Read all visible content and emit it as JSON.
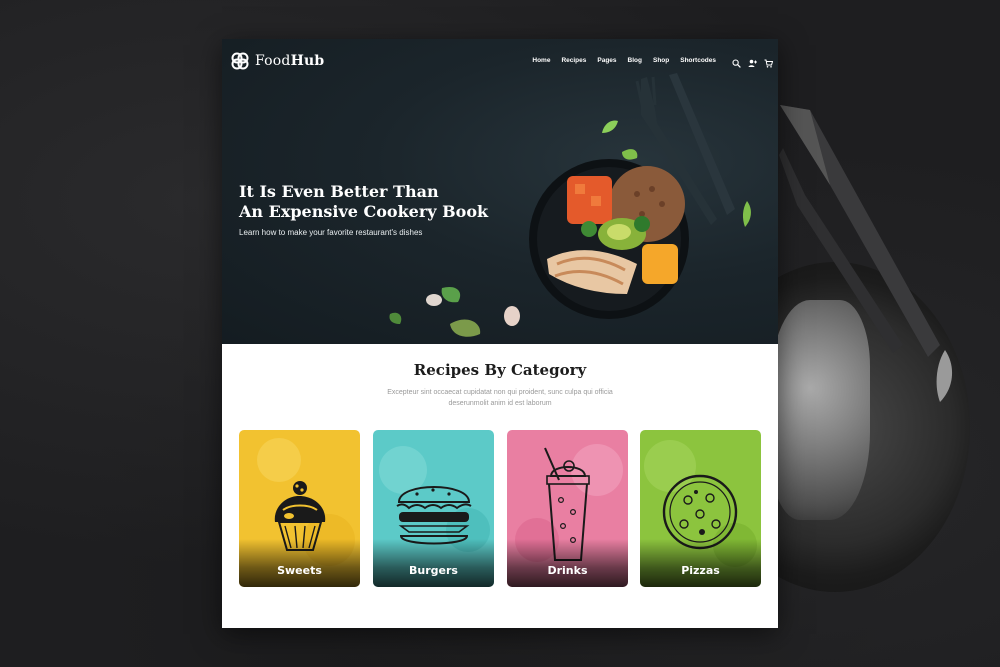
{
  "brand": {
    "name_part1": "Food",
    "name_part2": "Hub"
  },
  "nav": {
    "items": [
      {
        "label": "Home"
      },
      {
        "label": "Recipes"
      },
      {
        "label": "Pages"
      },
      {
        "label": "Blog"
      },
      {
        "label": "Shop"
      },
      {
        "label": "Shortcodes"
      }
    ],
    "icons": [
      "search-icon",
      "add-user-icon",
      "cart-icon"
    ]
  },
  "hero": {
    "title_line1": "It Is Even Better Than",
    "title_line2": "An Expensive Cookery Book",
    "subtitle": "Learn how to make your favorite restaurant's dishes"
  },
  "categories_section": {
    "title": "Recipes By Category",
    "description_line1": "Excepteur sint occaecat cupidatat non qui proident, sunc culpa qui officia",
    "description_line2": "deserunmolit anim id est laborum",
    "cards": [
      {
        "label": "Sweets",
        "color": "#f2c230",
        "icon": "cupcake-icon"
      },
      {
        "label": "Burgers",
        "color": "#5ccac8",
        "icon": "burger-icon"
      },
      {
        "label": "Drinks",
        "color": "#e97fa2",
        "icon": "milkshake-icon"
      },
      {
        "label": "Pizzas",
        "color": "#8cc43e",
        "icon": "pizza-icon"
      }
    ]
  },
  "colors": {
    "hero_bg": "#1b252b",
    "backdrop": "#1e1e20",
    "text_dark": "#1c1c1c",
    "text_muted": "#9a9a9a"
  }
}
